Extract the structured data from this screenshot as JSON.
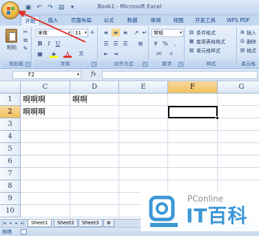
{
  "window": {
    "title": "Book1 - Microsoft Excel"
  },
  "quick_access": [
    {
      "icon": "save-icon",
      "glyph": "▣"
    },
    {
      "icon": "undo-icon",
      "glyph": "↶"
    },
    {
      "icon": "redo-icon",
      "glyph": "↷"
    },
    {
      "icon": "print-preview-icon",
      "glyph": "🗎"
    },
    {
      "icon": "customize-qat-icon",
      "glyph": "▾"
    }
  ],
  "tabs": [
    "开始",
    "插入",
    "页面布局",
    "公式",
    "数据",
    "审阅",
    "视图",
    "开发工具",
    "WPS PDF"
  ],
  "ribbon": {
    "clipboard": {
      "paste_label": "粘贴",
      "group_label": "剪贴板"
    },
    "font": {
      "font_name": "宋体",
      "font_size": "11",
      "group_label": "字体"
    },
    "alignment": {
      "group_label": "对齐方式"
    },
    "number": {
      "format": "常规",
      "group_label": "数字"
    },
    "styles": {
      "conditional": "条件格式",
      "table_format": "套用表格格式",
      "cell_styles": "单元格样式",
      "group_label": "样式"
    },
    "cells": {
      "insert": "插入",
      "delete": "删除",
      "format": "格式",
      "group_label": "单元格"
    }
  },
  "formula_bar": {
    "name_box": "F2",
    "fx_label": "fx",
    "formula": ""
  },
  "columns": [
    "C",
    "D",
    "E",
    "F",
    "G"
  ],
  "selected_column": "F",
  "rows": [
    "1",
    "2",
    "3",
    "4",
    "5",
    "6",
    "7",
    "8",
    "9",
    "10"
  ],
  "selected_row": "2",
  "cells": {
    "C1": "啊啊啊",
    "D1": "啊啊",
    "C2": "啊啊啊"
  },
  "sheet_tabs": [
    "Sheet1",
    "Sheet2",
    "Sheet3"
  ],
  "active_sheet": "Sheet1",
  "status": {
    "text": "就绪"
  },
  "watermark": {
    "brand": "PConline",
    "chinese": "IT百科"
  },
  "colors": {
    "accent": "#15428b",
    "selection_header": "#f1c15f",
    "annotation_arrow": "#e0302a",
    "watermark_blue": "#3b97d6"
  }
}
